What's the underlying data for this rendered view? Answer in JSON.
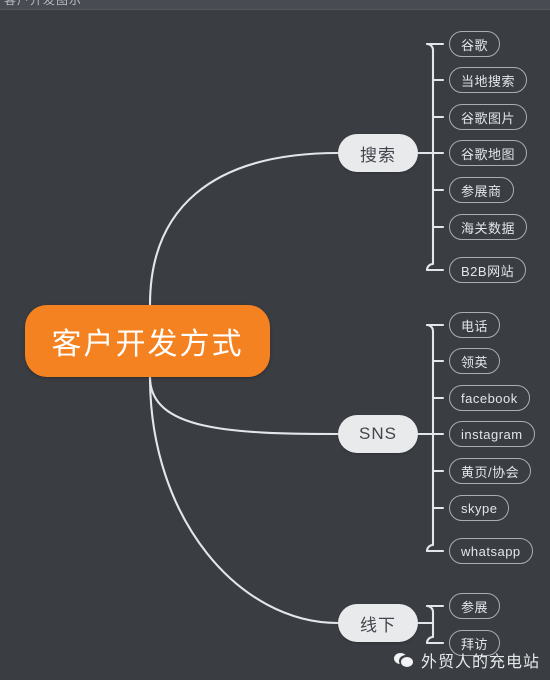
{
  "window": {
    "top_strip_text": "客户开发图示",
    "background_color": "#3a3d42"
  },
  "mindmap": {
    "root": {
      "label": "客户开发方式",
      "color": "#f58220",
      "text_color": "#ffffff"
    },
    "branches": [
      {
        "label": "搜索",
        "leaves": [
          {
            "label": "谷歌"
          },
          {
            "label": "当地搜索"
          },
          {
            "label": "谷歌图片"
          },
          {
            "label": "谷歌地图"
          },
          {
            "label": "参展商"
          },
          {
            "label": "海关数据"
          },
          {
            "label": "B2B网站"
          }
        ]
      },
      {
        "label": "SNS",
        "leaves": [
          {
            "label": "电话"
          },
          {
            "label": "领英"
          },
          {
            "label": "facebook"
          },
          {
            "label": "instagram"
          },
          {
            "label": "黄页/协会"
          },
          {
            "label": "skype"
          },
          {
            "label": "whatsapp"
          }
        ]
      },
      {
        "label": "线下",
        "leaves": [
          {
            "label": "参展"
          },
          {
            "label": "拜访"
          }
        ]
      }
    ],
    "node_colors": {
      "branch_fill": "#e9eaec",
      "branch_text": "#42464c",
      "leaf_border": "#a9adb4",
      "leaf_text": "#e3e5e8",
      "connector": "#e4e6e9"
    }
  },
  "watermark": {
    "icon": "wechat-icon",
    "label": "外贸人的充电站"
  }
}
